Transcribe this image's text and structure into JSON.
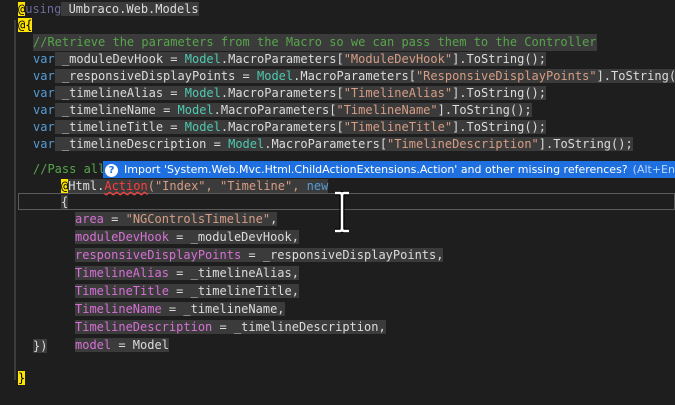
{
  "lines": {
    "l1_at": "@",
    "l1_using": "using",
    "l1_ns": " Umbraco.Web.Models",
    "l2_at": "@",
    "l2_brace": "{",
    "c1": "//Retrieve the parameters from the Macro so we can pass them to the Controller",
    "vars": [
      {
        "kw": "var",
        "name": " _moduleDevHook",
        "eq": " = ",
        "cls": "Model",
        "mid": ".MacroParameters[",
        "str": "\"ModuleDevHook\"",
        "end": "].ToString();"
      },
      {
        "kw": "var",
        "name": " _responsiveDisplayPoints",
        "eq": " = ",
        "cls": "Model",
        "mid": ".MacroParameters[",
        "str": "\"ResponsiveDisplayPoints\"",
        "end": "].ToString();"
      },
      {
        "kw": "var",
        "name": " _timelineAlias",
        "eq": " = ",
        "cls": "Model",
        "mid": ".MacroParameters[",
        "str": "\"TimelineAlias\"",
        "end": "].ToString();"
      },
      {
        "kw": "var",
        "name": " _timelineName",
        "eq": " = ",
        "cls": "Model",
        "mid": ".MacroParameters[",
        "str": "\"TimelineName\"",
        "end": "].ToString();"
      },
      {
        "kw": "var",
        "name": " _timelineTitle",
        "eq": " = ",
        "cls": "Model",
        "mid": ".MacroParameters[",
        "str": "\"TimelineTitle\"",
        "end": "].ToString();"
      },
      {
        "kw": "var",
        "name": " _timelineDescription",
        "eq": " = ",
        "cls": "Model",
        "mid": ".MacroParameters[",
        "str": "\"TimelineDescription\"",
        "end": "].ToString();"
      }
    ],
    "c2": "//Pass all",
    "html_at": "@",
    "html": "Html.",
    "action": "Action",
    "call_open": "(\"Index\", \"Timeline\", ",
    "new_kw": "new",
    "obj_open": "{",
    "props": [
      {
        "name": "area",
        "rest": " = ",
        "str": "\"NGControlsTimeline\"",
        "tail": ","
      },
      {
        "name": "moduleDevHook",
        "rest": " = _moduleDevHook,",
        "str": "",
        "tail": ""
      },
      {
        "name": "responsiveDisplayPoints",
        "rest": " = _responsiveDisplayPoints,",
        "str": "",
        "tail": ""
      },
      {
        "name": "TimelineAlias",
        "rest": " = _timelineAlias,",
        "str": "",
        "tail": ""
      },
      {
        "name": "TimelineTitle",
        "rest": " = _timelineTitle,",
        "str": "",
        "tail": ""
      },
      {
        "name": "TimelineName",
        "rest": " = _timelineName,",
        "str": "",
        "tail": ""
      },
      {
        "name": "TimelineDescription",
        "rest": " = _timelineDescription,",
        "str": "",
        "tail": ""
      },
      {
        "name": "model",
        "rest": " = Model",
        "str": "",
        "tail": ""
      }
    ],
    "obj_close": "})",
    "end_brace": "}"
  },
  "smart_tag": {
    "icon": "?",
    "message": "Import 'System.Web.Mvc.Html.ChildActionExtensions.Action' and other missing references?",
    "shortcut": "(Alt+Enter)"
  },
  "colors": {
    "background": "#1e1e1e",
    "smart_tag": "#1e6fe0",
    "razor_at": "#ffe400"
  }
}
